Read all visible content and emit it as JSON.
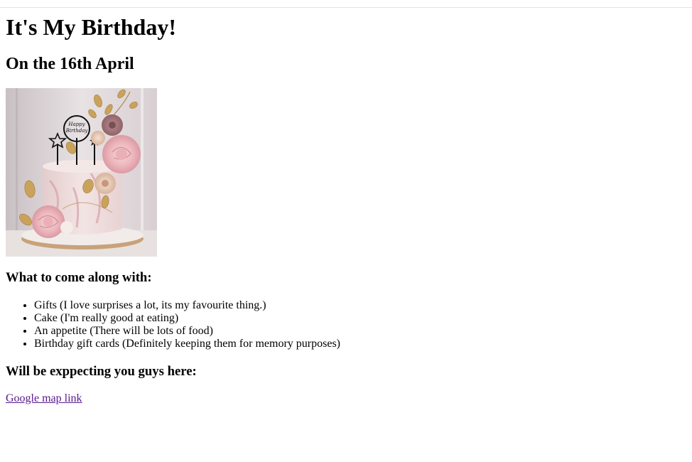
{
  "page": {
    "title": "It's My Birthday!",
    "subtitle": "On the 16th April"
  },
  "image": {
    "alt": "Birthday cake",
    "topper_text_line1": "Happy",
    "topper_text_line2": "Birthday"
  },
  "bring_section": {
    "heading": "What to come along with:",
    "items": [
      "Gifts (I love surprises a lot, its my favourite thing.)",
      "Cake (I'm really good at eating)",
      "An appetite (There will be lots of food)",
      "Birthday gift cards (Definitely keeping them for memory purposes)"
    ]
  },
  "location_section": {
    "heading": "Will be exppecting you guys here:",
    "link_text": "Google map link"
  },
  "colors": {
    "visited_link": "#551a8b",
    "text": "#000000",
    "background": "#ffffff"
  }
}
